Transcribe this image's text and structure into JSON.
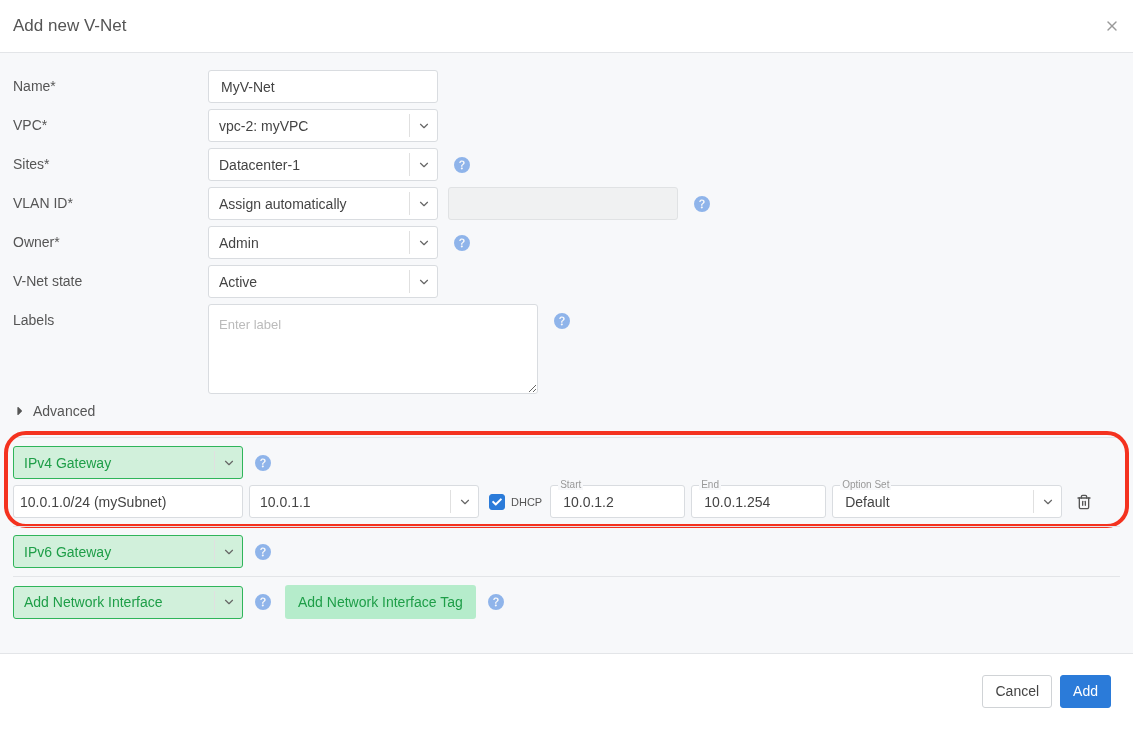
{
  "dialog": {
    "title": "Add new V-Net"
  },
  "fields": [
    {
      "kind": "text",
      "label": "Name*",
      "value": "MyV-Net",
      "help": false
    },
    {
      "kind": "select",
      "label": "VPC*",
      "value": "vpc-2: myVPC",
      "help": false
    },
    {
      "kind": "select",
      "label": "Sites*",
      "value": "Datacenter-1",
      "help": true
    },
    {
      "kind": "select_extra",
      "label": "VLAN ID*",
      "value": "Assign automatically",
      "extra_disabled": true,
      "help": true
    },
    {
      "kind": "select",
      "label": "Owner*",
      "value": "Admin",
      "help": true
    },
    {
      "kind": "select",
      "label": "V-Net state",
      "value": "Active",
      "help": false
    },
    {
      "kind": "textarea",
      "label": "Labels",
      "placeholder": "Enter label",
      "help": true
    }
  ],
  "advanced": {
    "label": "Advanced",
    "expanded": false
  },
  "ipv4": {
    "highlighted": true,
    "gateway": "IPv4 Gateway",
    "subnet": "10.0.1.0/24 (mySubnet)",
    "gateway_ip": "10.0.1.1",
    "dhcp": {
      "label": "DHCP",
      "checked": true
    },
    "start": {
      "label": "Start",
      "value": "10.0.1.2"
    },
    "end": {
      "label": "End",
      "value": "10.0.1.254"
    },
    "option_set": {
      "label": "Option Set",
      "value": "Default"
    }
  },
  "ipv6": {
    "gateway": "IPv6 Gateway"
  },
  "network": {
    "interface": "Add Network Interface",
    "tag_button": "Add Network Interface Tag"
  },
  "buttons": [
    {
      "kind": "secondary",
      "label": "Cancel"
    },
    {
      "kind": "primary",
      "label": "Add"
    }
  ]
}
